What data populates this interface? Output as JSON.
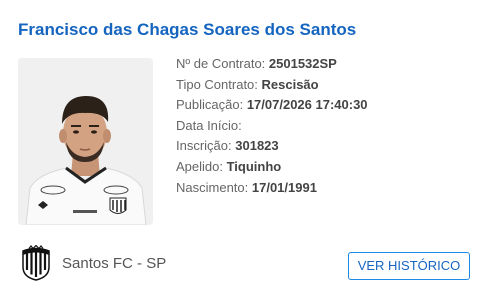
{
  "player": {
    "name": "Francisco das Chagas Soares dos Santos"
  },
  "details": [
    {
      "label": "Nº de Contrato: ",
      "value": "2501532SP"
    },
    {
      "label": "Tipo Contrato: ",
      "value": "Rescisão"
    },
    {
      "label": "Publicação: ",
      "value": "17/07/2026 17:40:30"
    },
    {
      "label": "Data Início: ",
      "value": ""
    },
    {
      "label": "Inscrição: ",
      "value": "301823"
    },
    {
      "label": "Apelido: ",
      "value": "Tiquinho"
    },
    {
      "label": "Nascimento: ",
      "value": "17/01/1991"
    }
  ],
  "club": {
    "name": "Santos FC - SP",
    "crest_icon": "santos-crest-icon"
  },
  "actions": {
    "history_label": "VER HISTÓRICO"
  },
  "colors": {
    "accent": "#1565c0",
    "button_border": "#1e88e5"
  }
}
